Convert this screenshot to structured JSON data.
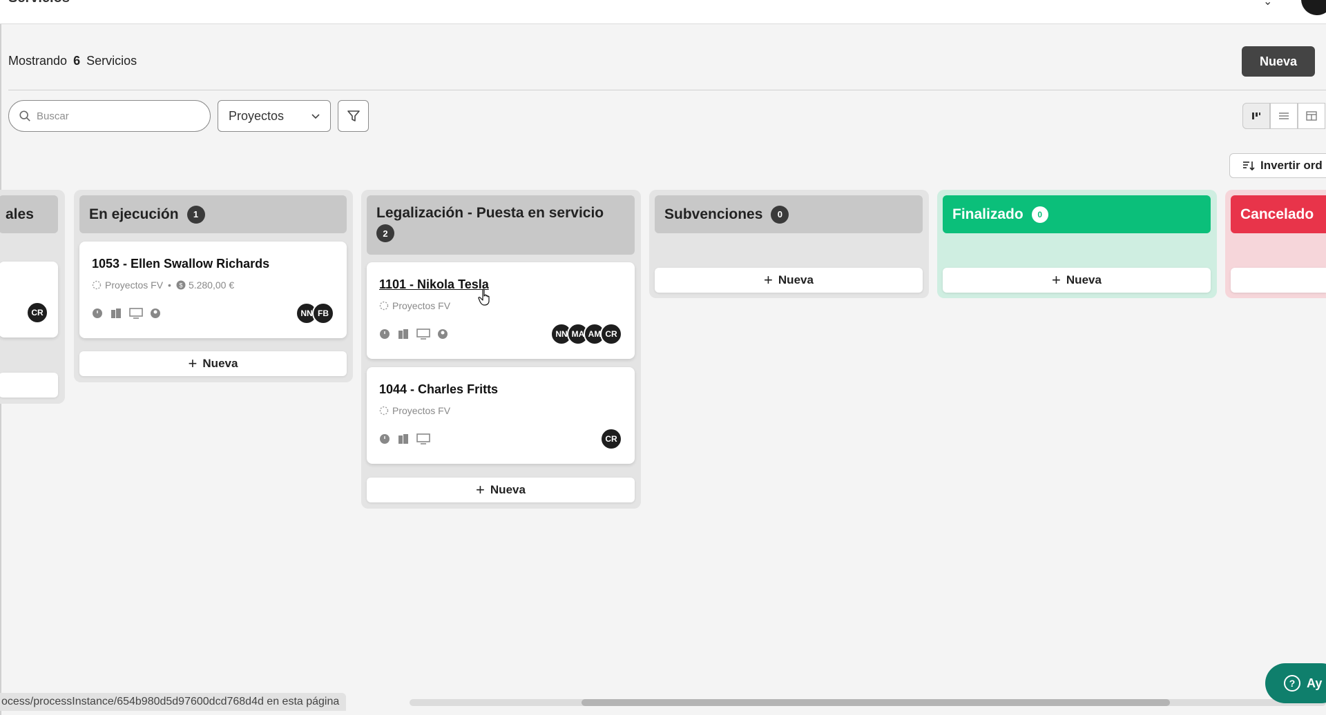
{
  "header": {
    "title": "Servicios"
  },
  "toolbar": {
    "showing_prefix": "Mostrando",
    "showing_count": "6",
    "showing_suffix": "Servicios",
    "new_button": "Nueva",
    "search_placeholder": "Buscar",
    "project_select": "Proyectos",
    "invert_order": "Invertir ord"
  },
  "columns": [
    {
      "title": "ales",
      "cards": [
        {
          "avatars": [
            "CR"
          ]
        }
      ]
    },
    {
      "title": "En ejecución",
      "count": "1",
      "cards": [
        {
          "title": "1053 - Ellen Swallow Richards",
          "project": "Proyectos FV",
          "amount": "5.280,00 €",
          "avatars": [
            "NN",
            "FB"
          ]
        }
      ],
      "add_label": "Nueva"
    },
    {
      "title": "Legalización - Puesta en servicio",
      "count": "2",
      "cards": [
        {
          "title": "1101 - Nikola Tesla",
          "project": "Proyectos FV",
          "avatars": [
            "NN",
            "MA",
            "AM",
            "CR"
          ]
        },
        {
          "title": "1044 - Charles Fritts",
          "project": "Proyectos FV",
          "avatars": [
            "CR"
          ]
        }
      ],
      "add_label": "Nueva"
    },
    {
      "title": "Subvenciones",
      "count": "0",
      "add_label": "Nueva"
    },
    {
      "title": "Finalizado",
      "count": "0",
      "add_label": "Nueva"
    },
    {
      "title": "Cancelado"
    }
  ],
  "footer": {
    "status_url": "ocess/processInstance/654b980d5d97600dcd768d4d en esta página",
    "help_label": "Ay"
  },
  "colors": {
    "finalizado": "#0bbf7a",
    "cancelado": "#e8344a",
    "primary_button": "#444444",
    "help": "#0f7f6c"
  }
}
